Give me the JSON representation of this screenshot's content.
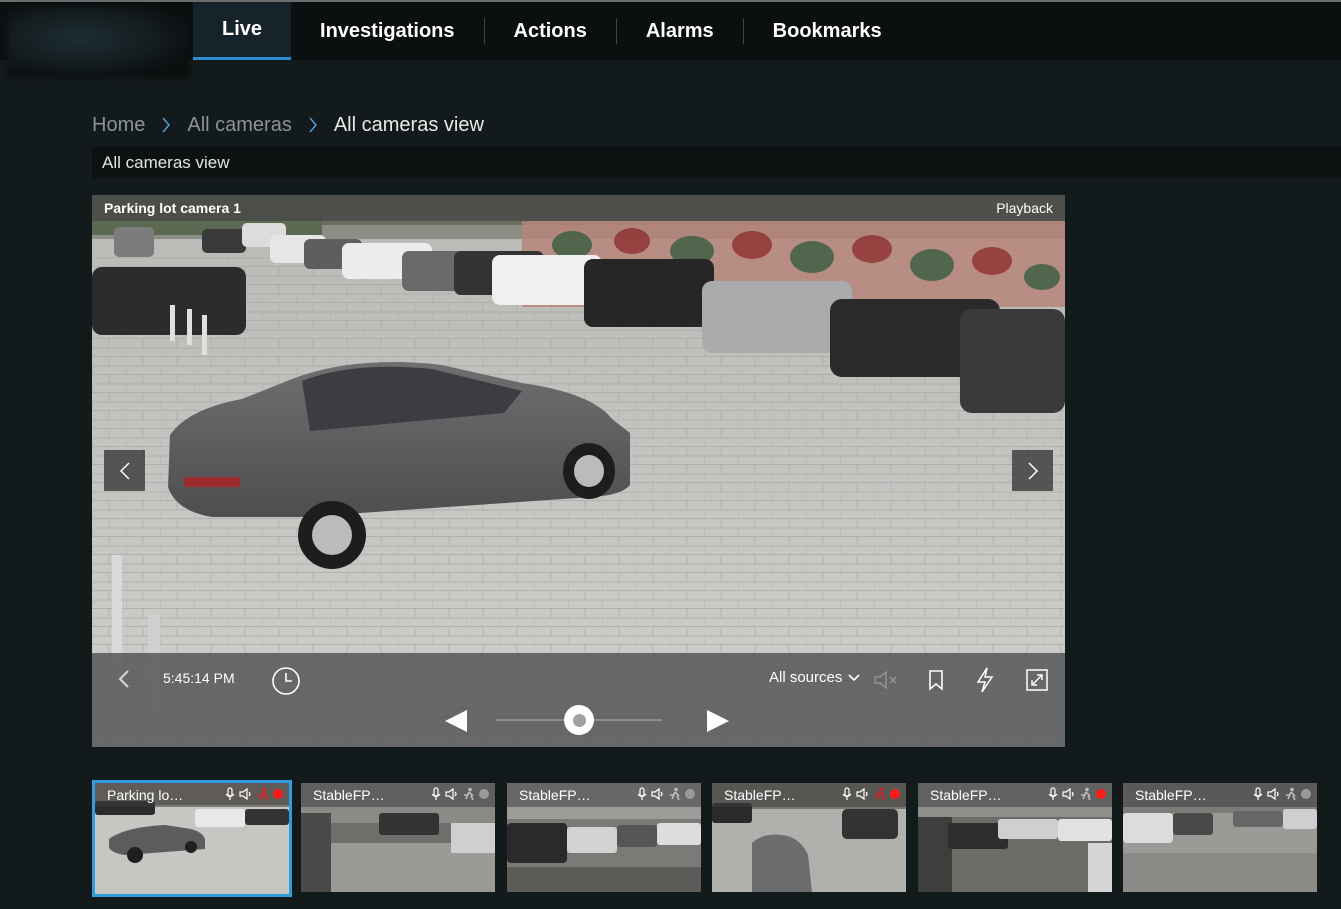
{
  "nav": {
    "items": [
      {
        "label": "Live",
        "active": true
      },
      {
        "label": "Investigations",
        "active": false
      },
      {
        "label": "Actions",
        "active": false
      },
      {
        "label": "Alarms",
        "active": false
      },
      {
        "label": "Bookmarks",
        "active": false
      }
    ]
  },
  "breadcrumb": {
    "items": [
      "Home",
      "All cameras",
      "All cameras view"
    ]
  },
  "view": {
    "title": "All cameras view"
  },
  "player": {
    "camera_name": "Parking lot camera 1",
    "mode": "Playback",
    "time": "5:45:14 PM",
    "sources_label": "All sources",
    "slider_position": 0.5,
    "icons": [
      "chevron-left-icon",
      "clock-icon",
      "speaker-muted-icon",
      "bookmark-icon",
      "lightning-icon",
      "fullscreen-icon",
      "play-reverse-icon",
      "play-icon"
    ]
  },
  "thumbnails": [
    {
      "label": "Parking lot ...",
      "rec_color": "#ff1a1a",
      "event_color": "#e02020",
      "selected": true
    },
    {
      "label": "StableFPS_...",
      "rec_color": "#9a9a9a",
      "event_color": "#bdbdbd",
      "selected": false
    },
    {
      "label": "StableFPS_...",
      "rec_color": "#9a9a9a",
      "event_color": "#bdbdbd",
      "selected": false
    },
    {
      "label": "StableFPS_...",
      "rec_color": "#ff1a1a",
      "event_color": "#e02020",
      "selected": false
    },
    {
      "label": "StableFPS_...",
      "rec_color": "#ff1a1a",
      "event_color": "#bdbdbd",
      "selected": false
    },
    {
      "label": "StableFPS_...",
      "rec_color": "#9a9a9a",
      "event_color": "#bdbdbd",
      "selected": false
    }
  ],
  "colors": {
    "accent": "#2e8fd0",
    "background": "#131a1b",
    "topbar": "#0b0f10"
  }
}
